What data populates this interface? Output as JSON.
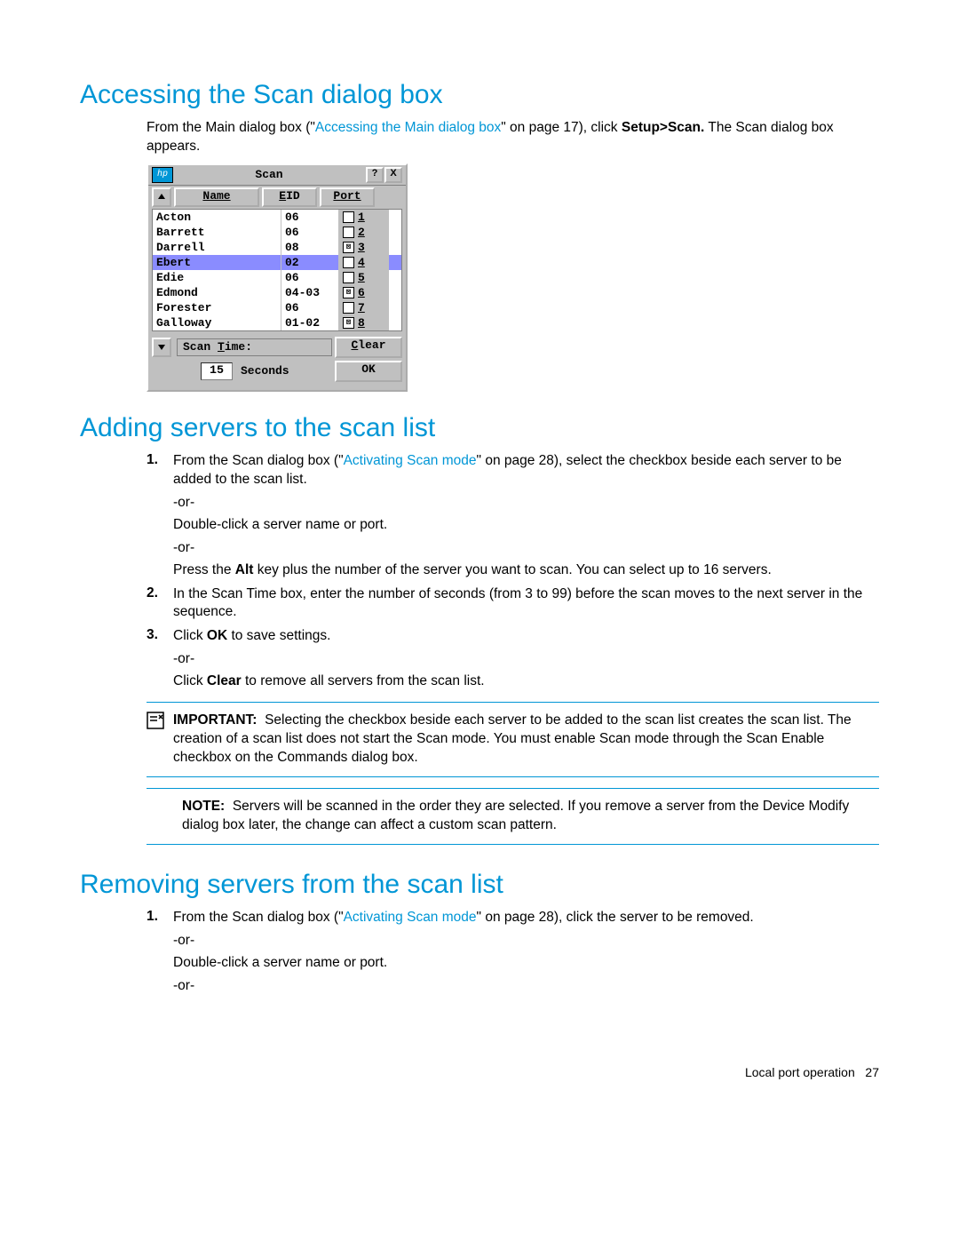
{
  "page": {
    "footer_text": "Local port operation",
    "footer_num": "27"
  },
  "section1": {
    "heading": "Accessing the Scan dialog box",
    "intro_a": "From the Main dialog box (\"",
    "intro_link": "Accessing the Main dialog box",
    "intro_b": "\" on page 17), click ",
    "intro_bold": "Setup>Scan.",
    "intro_c": " The Scan dialog box appears."
  },
  "dialog": {
    "title": "Scan",
    "help_btn": "?",
    "close_btn": "X",
    "headers": {
      "name": "Name",
      "eid": "EID",
      "port": "Port"
    },
    "rows": [
      {
        "name": "Acton",
        "port": "06",
        "checked": false,
        "num": "1",
        "selected": false
      },
      {
        "name": "Barrett",
        "port": "06",
        "checked": false,
        "num": "2",
        "selected": false
      },
      {
        "name": "Darrell",
        "port": "08",
        "checked": true,
        "num": "3",
        "selected": false
      },
      {
        "name": "Ebert",
        "port": "02",
        "checked": false,
        "num": "4",
        "selected": true
      },
      {
        "name": "Edie",
        "port": "06",
        "checked": false,
        "num": "5",
        "selected": false
      },
      {
        "name": "Edmond",
        "port": "04-03",
        "checked": true,
        "num": "6",
        "selected": false
      },
      {
        "name": "Forester",
        "port": "06",
        "checked": false,
        "num": "7",
        "selected": false
      },
      {
        "name": "Galloway",
        "port": "01-02",
        "checked": true,
        "num": "8",
        "selected": false
      }
    ],
    "scan_time_label": "Scan Time:",
    "scan_time_value": "15",
    "seconds_label": "Seconds",
    "clear_btn": "Clear",
    "ok_btn": "OK"
  },
  "section2": {
    "heading": "Adding servers to the scan list",
    "steps": [
      {
        "num": "1.",
        "pre": "From the Scan dialog box (\"",
        "link": "Activating Scan mode",
        "post": "\" on page 28), select the checkbox beside each server to be added to the scan list."
      },
      {
        "num": "2.",
        "text": "In the Scan Time box, enter the number of seconds (from 3 to 99) before the scan moves to the next server in the sequence."
      },
      {
        "num": "3.",
        "pre": "Click ",
        "bold": "OK",
        "post": " to save settings."
      }
    ],
    "or": "-or-",
    "step1_alt1": "Double-click a server name or port.",
    "step1_alt2_pre": "Press the ",
    "step1_alt2_bold": "Alt",
    "step1_alt2_post": " key plus the number of the server you want to scan. You can select up to 16 servers.",
    "step3_alt_pre": "Click ",
    "step3_alt_bold": "Clear",
    "step3_alt_post": " to remove all servers from the scan list.",
    "important_label": "IMPORTANT:",
    "important_text": "Selecting the checkbox beside each server to be added to the scan list creates the scan list. The creation of a scan list does not start the Scan mode. You must enable Scan mode through the Scan Enable checkbox on the Commands dialog box.",
    "note_label": "NOTE:",
    "note_text": "Servers will be scanned in the order they are selected. If you remove a server from the Device Modify dialog box later, the change can affect a custom scan pattern."
  },
  "section3": {
    "heading": "Removing servers from the scan list",
    "step1_num": "1.",
    "step1_pre": "From the Scan dialog box (\"",
    "step1_link": "Activating Scan mode",
    "step1_post": "\" on page 28), click the server to be removed.",
    "or": "-or-",
    "alt1": "Double-click a server name or port."
  }
}
